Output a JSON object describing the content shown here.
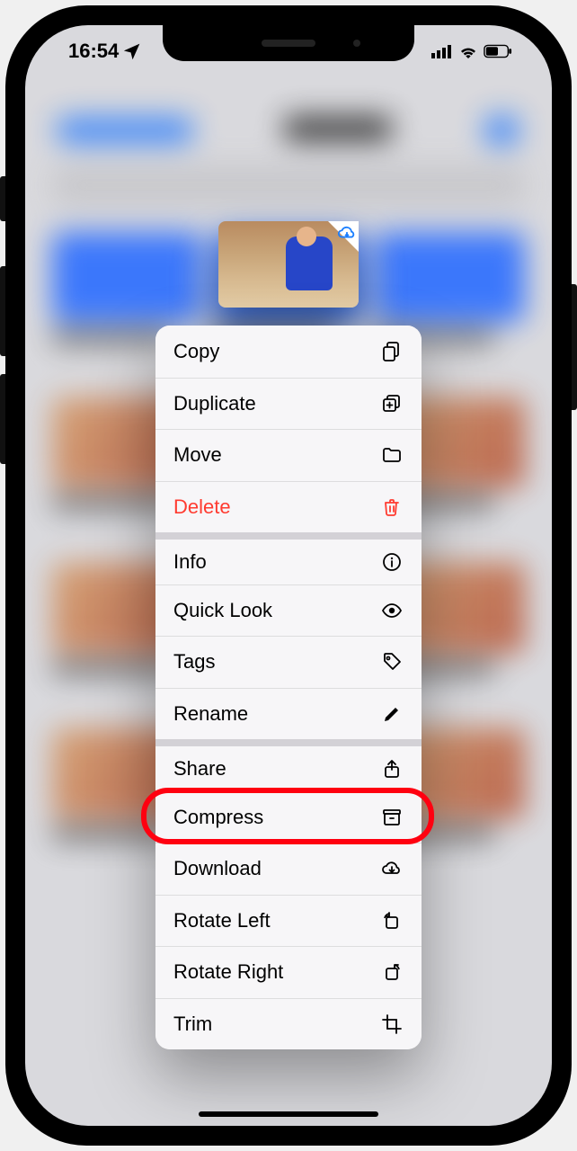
{
  "status": {
    "time": "16:54"
  },
  "contextMenu": {
    "items": [
      {
        "id": "copy",
        "label": "Copy",
        "icon": "doc-on-doc",
        "destructive": false,
        "section": false
      },
      {
        "id": "duplicate",
        "label": "Duplicate",
        "icon": "plus-square-on-square",
        "destructive": false,
        "section": false
      },
      {
        "id": "move",
        "label": "Move",
        "icon": "folder",
        "destructive": false,
        "section": false
      },
      {
        "id": "delete",
        "label": "Delete",
        "icon": "trash",
        "destructive": true,
        "section": false
      },
      {
        "id": "info",
        "label": "Info",
        "icon": "info-circle",
        "destructive": false,
        "section": true
      },
      {
        "id": "quicklook",
        "label": "Quick Look",
        "icon": "eye",
        "destructive": false,
        "section": false
      },
      {
        "id": "tags",
        "label": "Tags",
        "icon": "tag",
        "destructive": false,
        "section": false
      },
      {
        "id": "rename",
        "label": "Rename",
        "icon": "pencil",
        "destructive": false,
        "section": false
      },
      {
        "id": "share",
        "label": "Share",
        "icon": "share",
        "destructive": false,
        "section": true
      },
      {
        "id": "compress",
        "label": "Compress",
        "icon": "archivebox",
        "destructive": false,
        "section": false
      },
      {
        "id": "download",
        "label": "Download",
        "icon": "cloud-download",
        "destructive": false,
        "section": false
      },
      {
        "id": "rotateleft",
        "label": "Rotate Left",
        "icon": "rotate-left",
        "destructive": false,
        "section": false
      },
      {
        "id": "rotateright",
        "label": "Rotate Right",
        "icon": "rotate-right",
        "destructive": false,
        "section": false
      },
      {
        "id": "trim",
        "label": "Trim",
        "icon": "crop",
        "destructive": false,
        "section": false
      }
    ]
  },
  "annotation": {
    "highlightedItemIndex": 9
  }
}
